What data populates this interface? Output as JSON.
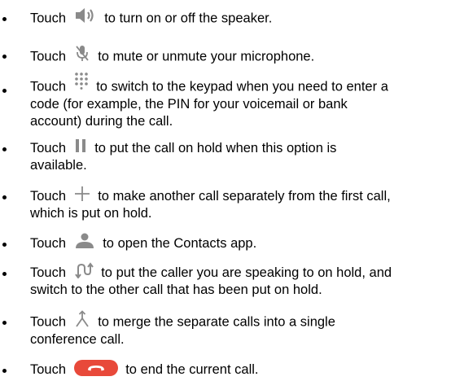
{
  "colors": {
    "text": "#000000",
    "icon": "#8a8a8a",
    "end_call": "#e8493a"
  },
  "items": [
    {
      "icon": "speaker-icon",
      "before": "Touch",
      "after": "to turn on or off the speaker."
    },
    {
      "icon": "mute-microphone-icon",
      "before": "Touch",
      "after": "to mute or unmute your microphone."
    },
    {
      "icon": "keypad-icon",
      "before": "Touch",
      "after": "to switch to the keypad when you need to enter a",
      "cont": "code (for example, the PIN for your voicemail or bank account) during the call."
    },
    {
      "icon": "pause-icon",
      "before": "Touch",
      "after": "to put the call on hold when this option is",
      "cont": "available."
    },
    {
      "icon": "plus-icon",
      "before": "Touch",
      "after": "to make another call separately from the first call,",
      "cont": "which is put on hold."
    },
    {
      "icon": "contact-person-icon",
      "before": "Touch",
      "after": "to open the Contacts app."
    },
    {
      "icon": "swap-calls-icon",
      "before": "Touch",
      "after": "to put the caller you are speaking to on hold, and",
      "cont": "switch to the other call that has been put on hold."
    },
    {
      "icon": "merge-calls-icon",
      "before": "Touch",
      "after": "to merge the separate calls into a single",
      "cont": "conference call."
    },
    {
      "icon": "end-call-icon",
      "before": "Touch",
      "after": "to end the current call."
    }
  ]
}
